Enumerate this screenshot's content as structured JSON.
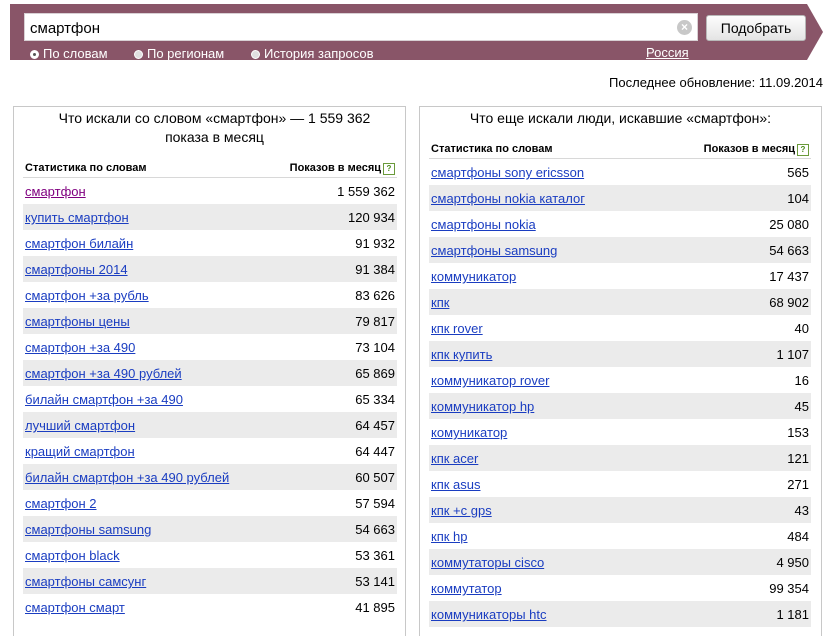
{
  "search": {
    "value": "смартфон",
    "submit_label": "Подобрать",
    "modes": [
      {
        "label": "По словам",
        "checked": true
      },
      {
        "label": "По регионам",
        "checked": false
      },
      {
        "label": "История запросов",
        "checked": false
      }
    ],
    "region": "Россия"
  },
  "last_update": "Последнее обновление: 11.09.2014",
  "left_panel": {
    "title": "Что искали со словом «смартфон» — 1 559 362 показа в месяц",
    "col_keyword": "Статистика по словам",
    "col_count": "Показов в месяц",
    "rows": [
      {
        "kw": "смартфон",
        "n": "1 559 362"
      },
      {
        "kw": "купить смартфон",
        "n": "120 934"
      },
      {
        "kw": "смартфон билайн",
        "n": "91 932"
      },
      {
        "kw": "смартфоны 2014",
        "n": "91 384"
      },
      {
        "kw": "смартфон +за рубль",
        "n": "83 626"
      },
      {
        "kw": "смартфоны цены",
        "n": "79 817"
      },
      {
        "kw": "смартфон +за 490",
        "n": "73 104"
      },
      {
        "kw": "смартфон +за 490 рублей",
        "n": "65 869"
      },
      {
        "kw": "билайн смартфон +за 490",
        "n": "65 334"
      },
      {
        "kw": "лучший смартфон",
        "n": "64 457"
      },
      {
        "kw": "кращий смартфон",
        "n": "64 447"
      },
      {
        "kw": "билайн смартфон +за 490 рублей",
        "n": "60 507"
      },
      {
        "kw": "смартфон 2",
        "n": "57 594"
      },
      {
        "kw": "смартфоны samsung",
        "n": "54 663"
      },
      {
        "kw": "смартфон black",
        "n": "53 361"
      },
      {
        "kw": "смартфоны самсунг",
        "n": "53 141"
      },
      {
        "kw": "смартфон смарт",
        "n": "41 895"
      }
    ]
  },
  "right_panel": {
    "title": "Что еще искали люди, искавшие «смартфон»:",
    "col_keyword": "Статистика по словам",
    "col_count": "Показов в месяц",
    "rows": [
      {
        "kw": "смартфоны sony ericsson",
        "n": "565"
      },
      {
        "kw": "смартфоны nokia каталог",
        "n": "104"
      },
      {
        "kw": "смартфоны nokia",
        "n": "25 080"
      },
      {
        "kw": "смартфоны samsung",
        "n": "54 663"
      },
      {
        "kw": "коммуникатор",
        "n": "17 437"
      },
      {
        "kw": "кпк",
        "n": "68 902"
      },
      {
        "kw": "кпк rover",
        "n": "40"
      },
      {
        "kw": "кпк купить",
        "n": "1 107"
      },
      {
        "kw": "коммуникатор rover",
        "n": "16"
      },
      {
        "kw": "коммуникатор hp",
        "n": "45"
      },
      {
        "kw": "комуникатор",
        "n": "153"
      },
      {
        "kw": "кпк acer",
        "n": "121"
      },
      {
        "kw": "кпк asus",
        "n": "271"
      },
      {
        "kw": "кпк +с gps",
        "n": "43"
      },
      {
        "kw": "кпк hp",
        "n": "484"
      },
      {
        "kw": "коммутаторы cisco",
        "n": "4 950"
      },
      {
        "kw": "коммутатор",
        "n": "99 354"
      },
      {
        "kw": "коммуникаторы htc",
        "n": "1 181"
      }
    ]
  },
  "icons": {
    "clear": "clear-icon",
    "help": "help-icon",
    "radio": "radio-icon"
  },
  "colors": {
    "header_bg": "#895568",
    "link": "#1a3dc1",
    "visited_link": "#800080",
    "row_stripe": "#ebebeb"
  }
}
